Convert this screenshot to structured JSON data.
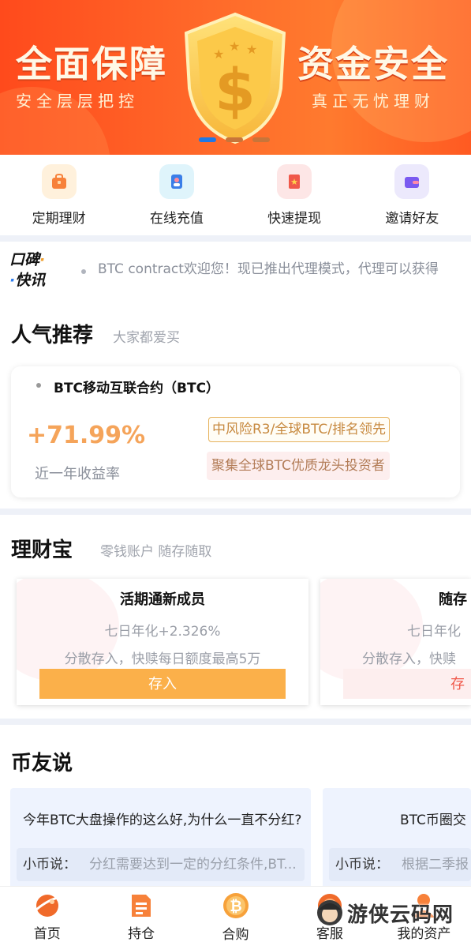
{
  "banner": {
    "left_title": "全面保障",
    "left_sub": "安全层层把控",
    "right_title": "资金安全",
    "right_sub": "真正无忧理财",
    "active_slide": 1,
    "slide_count": 3
  },
  "quick_menu": [
    {
      "label": "定期理财",
      "icon": "bag-icon",
      "color": "#f7813a",
      "bg": "#fff1dc"
    },
    {
      "label": "在线充值",
      "icon": "user-card-icon",
      "color": "#3a7ee8",
      "bg": "#dff4fb"
    },
    {
      "label": "快速提现",
      "icon": "bookmark-star-icon",
      "color": "#f0584a",
      "bg": "#fde6e6"
    },
    {
      "label": "邀请好友",
      "icon": "wallet-icon",
      "color": "#7a5af0",
      "bg": "#ece9fc"
    }
  ],
  "ticker": {
    "logo_line1": "口碑",
    "logo_line2": "快讯",
    "message": "BTC contract欢迎您！现已推出代理模式，代理可以获得"
  },
  "popular": {
    "title": "人气推荐",
    "subtitle": "大家都爱买",
    "product_name": "BTC移动互联合约（BTC）",
    "rate": "+71.99%",
    "rate_label": "近一年收益率",
    "tag_risk": "中风险R3/全球BTC/排名领先",
    "tag_desc": "聚集全球BTC优质龙头投资者"
  },
  "savings": {
    "title": "理财宝",
    "subtitle": "零钱账户 随存随取",
    "cards": [
      {
        "name": "活期通新成员",
        "rate": "七日年化+2.326%",
        "desc": "分散存入，快赎每日额度最高5万",
        "button": "存入"
      },
      {
        "name": "随存",
        "rate": "七日年化",
        "desc": "分散存入，快赎",
        "button": "存"
      }
    ]
  },
  "talk": {
    "title": "币友说",
    "cards": [
      {
        "question": "今年BTC大盘操作的这么好,为什么一直不分红?",
        "who": "小币说：",
        "answer": "分红需要达到一定的分红条件,BT..."
      },
      {
        "question": "BTC币圈交",
        "who": "小币说：",
        "answer": "根据二季报"
      }
    ]
  },
  "bottom_nav": [
    {
      "label": "首页",
      "icon": "home-planet-icon",
      "active": true
    },
    {
      "label": "持仓",
      "icon": "document-icon",
      "active": false
    },
    {
      "label": "合购",
      "icon": "bitcoin-icon",
      "active": false
    },
    {
      "label": "客服",
      "icon": "headset-icon",
      "active": false
    },
    {
      "label": "我的资产",
      "icon": "user-icon",
      "active": false
    }
  ],
  "watermark": "游侠云码网"
}
